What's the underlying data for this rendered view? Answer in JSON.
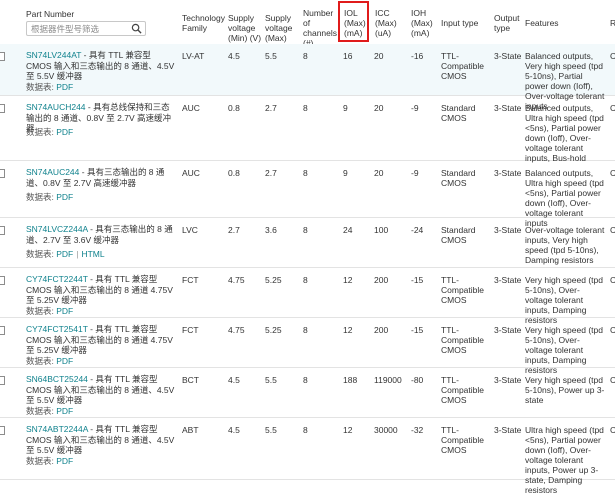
{
  "header": {
    "part_number": "Part Number",
    "search_placeholder": "根据器件型号筛选",
    "technology_family": "Technology Family",
    "supply_min": "Supply voltage (Min) (V)",
    "supply_max": "Supply voltage (Max) (V)",
    "channels": "Number of channels (#)",
    "iol": "IOL (Max) (mA)",
    "icc": "ICC (Max) (uA)",
    "ioh": "IOH (Max) (mA)",
    "input_type": "Input type",
    "output_type": "Output type",
    "features": "Features",
    "next_col": "R"
  },
  "rows": [
    {
      "part": "SN74LV244AT",
      "desc": " - 具有 TTL 兼容型 CMOS 输入和三态输出的 8 通道、4.5V 至 5.5V 缓冲器",
      "ds_label": "数据表:",
      "ds_links": [
        "PDF"
      ],
      "tech": "LV-AT",
      "vmin": "4.5",
      "vmax": "5.5",
      "ch": "8",
      "iol": "16",
      "icc": "20",
      "ioh": "-16",
      "input": "TTL-Compatible CMOS",
      "output": "3-State",
      "features": "Balanced outputs, Very high speed (tpd 5-10ns), Partial power down (Ioff), Over-voltage tolerant inputs",
      "next": "C"
    },
    {
      "part": "SN74AUCH244",
      "desc": " - 具有总线保持和三态输出的 8 通道、0.8V 至 2.7V 高速缓冲器",
      "ds_label": "数据表:",
      "ds_links": [
        "PDF"
      ],
      "tech": "AUC",
      "vmin": "0.8",
      "vmax": "2.7",
      "ch": "8",
      "iol": "9",
      "icc": "20",
      "ioh": "-9",
      "input": "Standard CMOS",
      "output": "3-State",
      "features": "Balanced outputs, Ultra high speed (tpd <5ns), Partial power down (Ioff), Over-voltage tolerant inputs, Bus-hold",
      "next": "C"
    },
    {
      "part": "SN74AUC244",
      "desc": " - 具有三态输出的 8 通道、0.8V 至 2.7V 高速缓冲器",
      "ds_label": "数据表:",
      "ds_links": [
        "PDF"
      ],
      "tech": "AUC",
      "vmin": "0.8",
      "vmax": "2.7",
      "ch": "8",
      "iol": "9",
      "icc": "20",
      "ioh": "-9",
      "input": "Standard CMOS",
      "output": "3-State",
      "features": "Balanced outputs, Ultra high speed (tpd <5ns), Partial power down (Ioff), Over-voltage tolerant inputs",
      "next": "C"
    },
    {
      "part": "SN74LVCZ244A",
      "desc": " - 具有三态输出的 8 通道、2.7V 至 3.6V 缓冲器",
      "ds_label": "数据表:",
      "ds_links": [
        "PDF",
        "HTML"
      ],
      "tech": "LVC",
      "vmin": "2.7",
      "vmax": "3.6",
      "ch": "8",
      "iol": "24",
      "icc": "100",
      "ioh": "-24",
      "input": "Standard CMOS",
      "output": "3-State",
      "features": "Over-voltage tolerant inputs, Very high speed (tpd 5-10ns), Damping resistors",
      "next": "C"
    },
    {
      "part": "CY74FCT2244T",
      "desc": " - 具有 TTL 兼容型 CMOS 输入和三态输出的 8 通道 4.75V 至 5.25V 缓冲器",
      "ds_label": "数据表:",
      "ds_links": [
        "PDF"
      ],
      "tech": "FCT",
      "vmin": "4.75",
      "vmax": "5.25",
      "ch": "8",
      "iol": "12",
      "icc": "200",
      "ioh": "-15",
      "input": "TTL-Compatible CMOS",
      "output": "3-State",
      "features": "Very high speed (tpd 5-10ns), Over-voltage tolerant inputs, Damping resistors",
      "next": "C"
    },
    {
      "part": "CY74FCT2541T",
      "desc": " - 具有 TTL 兼容型 CMOS 输入和三态输出的 8 通道 4.75V 至 5.25V 缓冲器",
      "ds_label": "数据表:",
      "ds_links": [
        "PDF"
      ],
      "tech": "FCT",
      "vmin": "4.75",
      "vmax": "5.25",
      "ch": "8",
      "iol": "12",
      "icc": "200",
      "ioh": "-15",
      "input": "TTL-Compatible CMOS",
      "output": "3-State",
      "features": "Very high speed (tpd 5-10ns), Over-voltage tolerant inputs, Damping resistors",
      "next": "C"
    },
    {
      "part": "SN64BCT25244",
      "desc": " - 具有 TTL 兼容型 CMOS 输入和三态输出的 8 通道、4.5V 至 5.5V 缓冲器",
      "ds_label": "数据表:",
      "ds_links": [
        "PDF"
      ],
      "tech": "BCT",
      "vmin": "4.5",
      "vmax": "5.5",
      "ch": "8",
      "iol": "188",
      "icc": "119000",
      "ioh": "-80",
      "input": "TTL-Compatible CMOS",
      "output": "3-State",
      "features": "Very high speed (tpd 5-10ns), Power up 3-state",
      "next": "C"
    },
    {
      "part": "SN74ABT2244A",
      "desc": " - 具有 TTL 兼容型 CMOS 输入和三态输出的 8 通道、4.5V 至 5.5V 缓冲器",
      "ds_label": "数据表:",
      "ds_links": [
        "PDF"
      ],
      "tech": "ABT",
      "vmin": "4.5",
      "vmax": "5.5",
      "ch": "8",
      "iol": "12",
      "icc": "30000",
      "ioh": "-32",
      "input": "TTL-Compatible CMOS",
      "output": "3-State",
      "features": "Ultra high speed (tpd <5ns), Partial power down (Ioff), Over-voltage tolerant inputs, Power up 3-state, Damping resistors",
      "next": "C"
    }
  ]
}
